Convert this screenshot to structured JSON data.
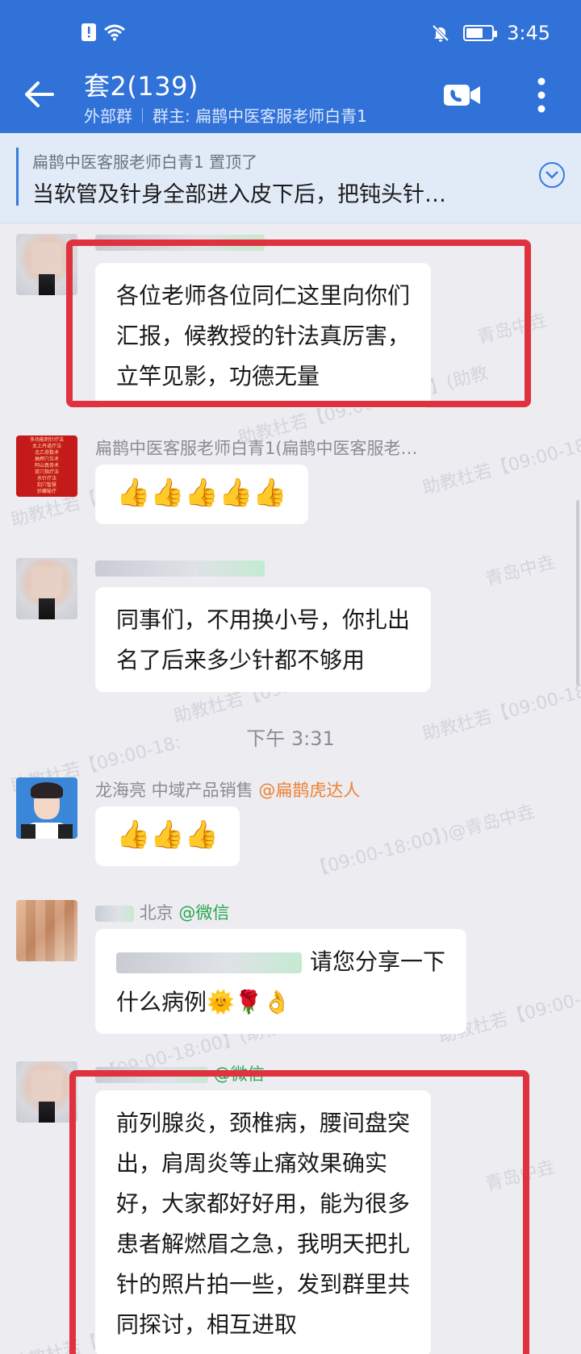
{
  "status_bar": {
    "time": "3:45"
  },
  "header": {
    "title": "套2(139)",
    "group_type": "外部群",
    "owner": "群主: 扁鹊中医客服老师白青1"
  },
  "pinned": {
    "by": "扁鹊中医客服老师白青1 置顶了",
    "text": "当软管及针身全部进入皮下后，把钝头针…"
  },
  "messages": {
    "m1": {
      "lines": [
        "各位老师各位同仁这里向你们",
        "汇报，候教授的针法真厉害，",
        "立竿见影，功德无量"
      ]
    },
    "m2": {
      "sender": "扁鹊中医客服老师白青1(扁鹊中医客服老…",
      "avatar_lines": [
        "多功能刺针疗法",
        "太上丹道疗法",
        "北乙奇数术",
        "抽押穴位术",
        "阿山真奇术",
        "双穴指疗法",
        "水针疗法",
        "刮穴智慧",
        "妙藏秘疗"
      ],
      "emoji": "👍👍👍👍👍"
    },
    "m3": {
      "lines": [
        "同事们，不用换小号，你扎出",
        "名了后来多少针都不够用"
      ]
    },
    "timestamp": "下午 3:31",
    "m4": {
      "sender": "龙海亮 中域产品销售",
      "mention": "@扁鹊虎达人",
      "emoji": "👍👍👍"
    },
    "m5": {
      "sender": "北京",
      "mention": "@微信",
      "line1": "请您分享一下",
      "line2": "什么病例🌞🌹👌"
    },
    "m6": {
      "mention": "@微信",
      "lines": [
        "前列腺炎，颈椎病，腰间盘突",
        "出，肩周炎等止痛效果确实",
        "好，大家都好好用，能为很多",
        "患者解燃眉之急，我明天把扎",
        "针的照片拍一些，发到群里共",
        "同探讨，相互进取"
      ]
    }
  },
  "watermarks": [
    "助教杜若【09:00-18:00】(助教",
    "青岛中垚",
    "助教杜若【09:00-18:",
    "助教杜若【09:00-18:",
    "青岛中垚",
    "助教杜若【09:00-18:00】(助教",
    "助教杜若【09:00-18:",
    "【09:00-18:00】)@青岛中垚",
    "助教杜若【09:00-18:",
    "【09:00-18:00】(助教",
    "助教杜若【09:00-18:",
    "青岛中垚",
    "助教杜若【09:00-18:00】"
  ],
  "colors": {
    "header_blue": "#3072d8",
    "highlight_red": "#e0323e",
    "mention_orange": "#ee8132",
    "mention_green": "#27a94e"
  }
}
